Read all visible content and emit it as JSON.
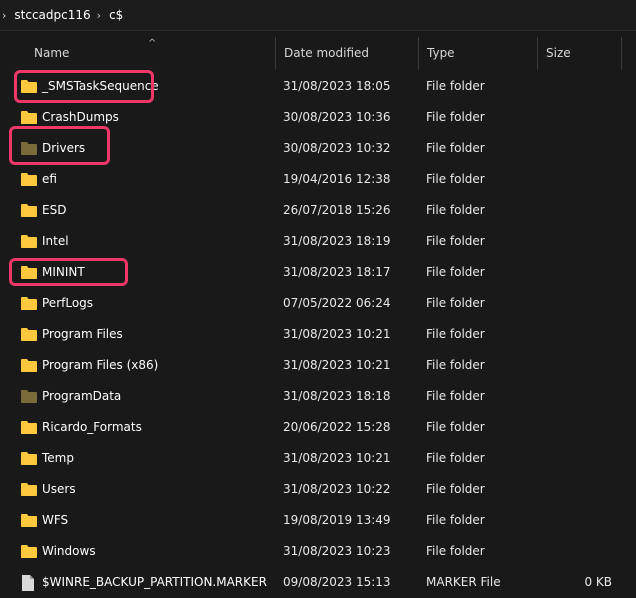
{
  "breadcrumb": {
    "parts": [
      "stccadpc116",
      "c$"
    ]
  },
  "columns": {
    "name": "Name",
    "date": "Date modified",
    "type": "Type",
    "size": "Size"
  },
  "colors": {
    "folder": "#ffc83d",
    "folder_dark": "#7a6a3a",
    "highlight": "#f03769"
  },
  "rows": [
    {
      "name": "_SMSTaskSequence",
      "date": "31/08/2023 18:05",
      "type": "File folder",
      "size": "",
      "icon": "folder-icon"
    },
    {
      "name": "CrashDumps",
      "date": "30/08/2023 10:36",
      "type": "File folder",
      "size": "",
      "icon": "folder-icon"
    },
    {
      "name": "Drivers",
      "date": "30/08/2023 10:32",
      "type": "File folder",
      "size": "",
      "icon": "folder-icon"
    },
    {
      "name": "efi",
      "date": "19/04/2016 12:38",
      "type": "File folder",
      "size": "",
      "icon": "folder-icon"
    },
    {
      "name": "ESD",
      "date": "26/07/2018 15:26",
      "type": "File folder",
      "size": "",
      "icon": "folder-icon"
    },
    {
      "name": "Intel",
      "date": "31/08/2023 18:19",
      "type": "File folder",
      "size": "",
      "icon": "folder-icon"
    },
    {
      "name": "MININT",
      "date": "31/08/2023 18:17",
      "type": "File folder",
      "size": "",
      "icon": "folder-icon"
    },
    {
      "name": "PerfLogs",
      "date": "07/05/2022 06:24",
      "type": "File folder",
      "size": "",
      "icon": "folder-icon"
    },
    {
      "name": "Program Files",
      "date": "31/08/2023 10:21",
      "type": "File folder",
      "size": "",
      "icon": "folder-icon"
    },
    {
      "name": "Program Files (x86)",
      "date": "31/08/2023 10:21",
      "type": "File folder",
      "size": "",
      "icon": "folder-icon"
    },
    {
      "name": "ProgramData",
      "date": "31/08/2023 18:18",
      "type": "File folder",
      "size": "",
      "icon": "folder-icon"
    },
    {
      "name": "Ricardo_Formats",
      "date": "20/06/2022 15:28",
      "type": "File folder",
      "size": "",
      "icon": "folder-icon"
    },
    {
      "name": "Temp",
      "date": "31/08/2023 10:21",
      "type": "File folder",
      "size": "",
      "icon": "folder-icon"
    },
    {
      "name": "Users",
      "date": "31/08/2023 10:22",
      "type": "File folder",
      "size": "",
      "icon": "folder-icon"
    },
    {
      "name": "WFS",
      "date": "19/08/2019 13:49",
      "type": "File folder",
      "size": "",
      "icon": "folder-icon"
    },
    {
      "name": "Windows",
      "date": "31/08/2023 10:23",
      "type": "File folder",
      "size": "",
      "icon": "folder-icon"
    },
    {
      "name": "$WINRE_BACKUP_PARTITION.MARKER",
      "date": "09/08/2023 15:13",
      "type": "MARKER File",
      "size": "0 KB",
      "icon": "file-icon"
    }
  ]
}
